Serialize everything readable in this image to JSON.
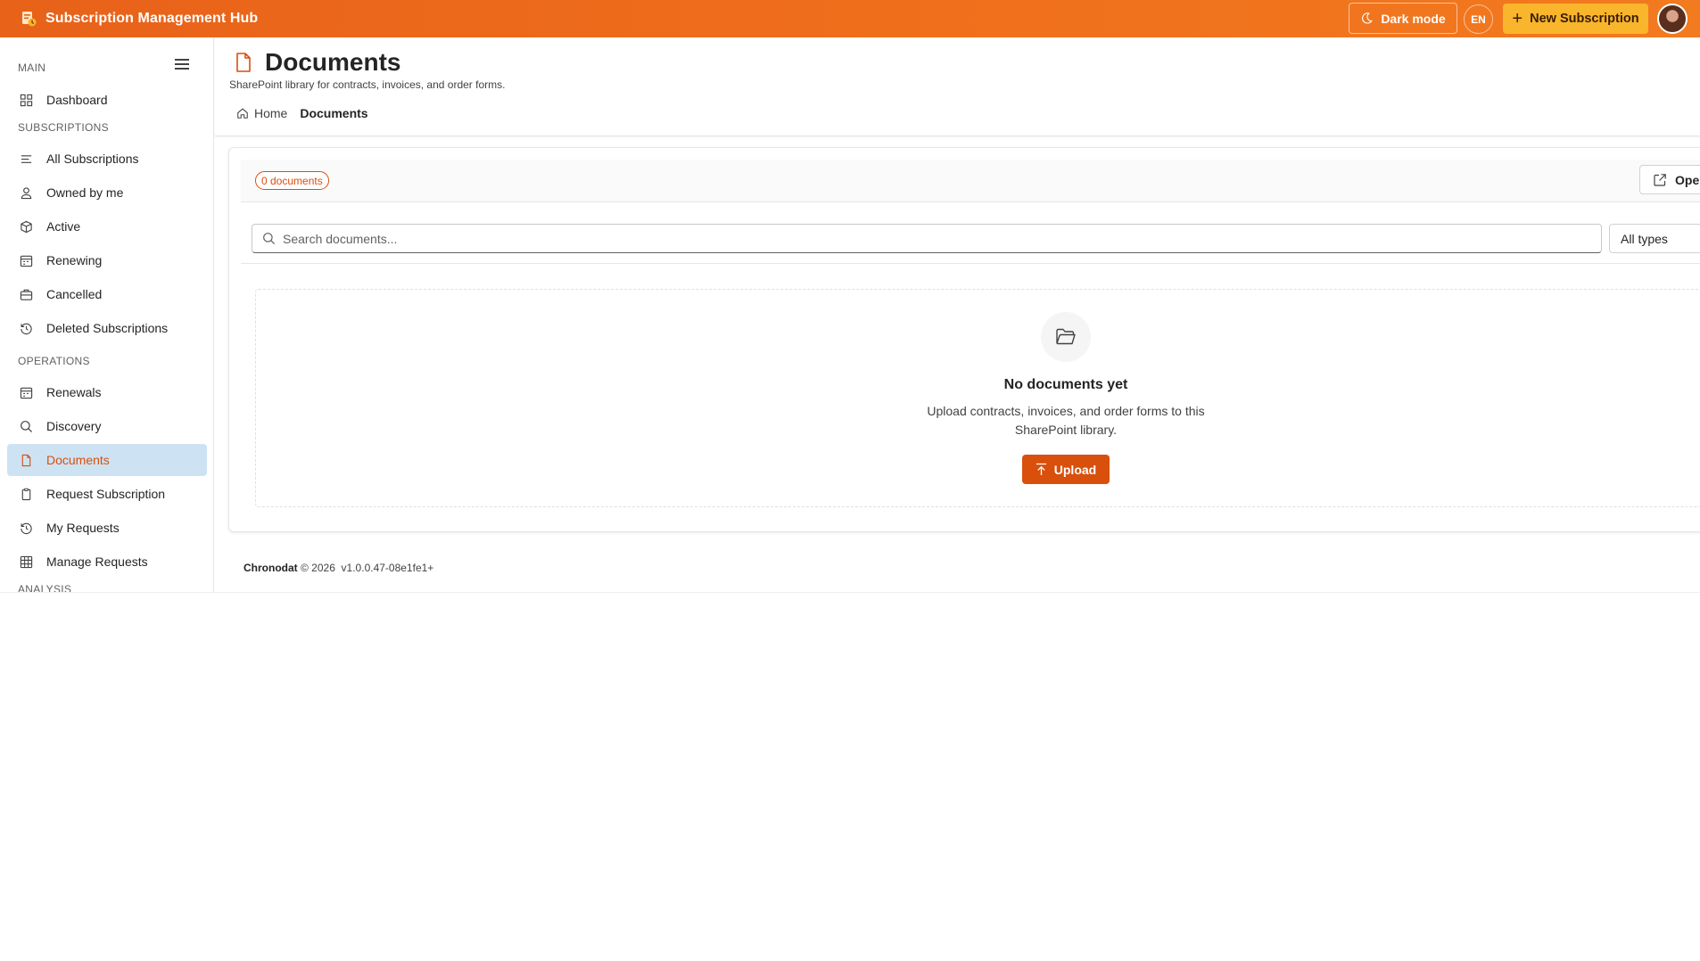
{
  "app": {
    "title": "Subscription Management Hub"
  },
  "topbar": {
    "dark_mode_label": "Dark mode",
    "language_label": "EN",
    "new_subscription_label": "New Subscription"
  },
  "sidebar": {
    "sections": {
      "main": "MAIN",
      "subscriptions": "SUBSCRIPTIONS",
      "operations": "OPERATIONS",
      "analysis": "ANALYSIS"
    },
    "items": {
      "dashboard": "Dashboard",
      "all_subscriptions": "All Subscriptions",
      "owned_by_me": "Owned by me",
      "active": "Active",
      "renewing": "Renewing",
      "cancelled": "Cancelled",
      "deleted_subscriptions": "Deleted Subscriptions",
      "renewals": "Renewals",
      "discovery": "Discovery",
      "documents": "Documents",
      "request_subscription": "Request Subscription",
      "my_requests": "My Requests",
      "manage_requests": "Manage Requests"
    },
    "active_item": "documents"
  },
  "page": {
    "title": "Documents",
    "subtitle": "SharePoint library for contracts, invoices, and order forms.",
    "breadcrumb": {
      "home": "Home",
      "current": "Documents"
    }
  },
  "toolbar": {
    "count_badge": "0 documents",
    "open_label": "Open in SharePoint",
    "search_placeholder": "Search documents...",
    "type_filter_value": "All types"
  },
  "empty_state": {
    "title": "No documents yet",
    "text": "Upload contracts, invoices, and order forms to this SharePoint library.",
    "upload_label": "Upload"
  },
  "footer": {
    "company": "Chronodat",
    "copyright": "© 2026",
    "version": "v1.0.0.47-08e1fe1+"
  },
  "colors": {
    "header_orange": "#e8621a",
    "accent": "#d94f0c",
    "new_button": "#f9b52b",
    "active_nav_bg": "#cde3f4"
  }
}
